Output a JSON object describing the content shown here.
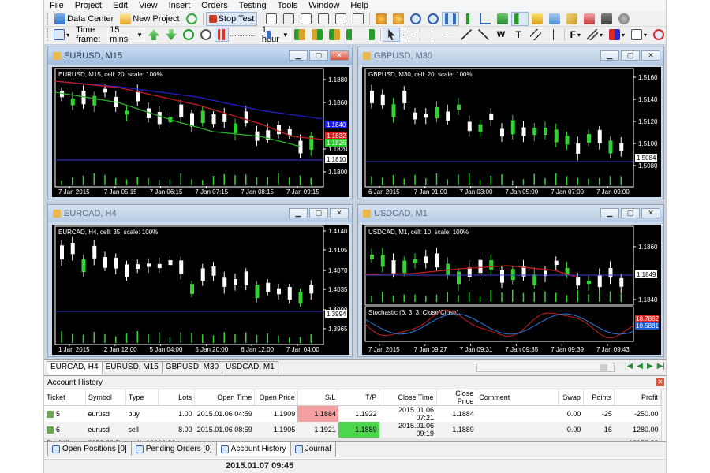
{
  "menu": [
    "File",
    "Project",
    "Edit",
    "View",
    "Insert",
    "Orders",
    "Testing",
    "Tools",
    "Window",
    "Help"
  ],
  "toolbar": {
    "data_center_label": "Data Center",
    "new_project_label": "New Project",
    "stop_test_label": "Stop Test",
    "timeframe_label": "Time frame:",
    "timeframe_value": "15 mins",
    "speed_value": "1 hour",
    "f_menu_label": "F"
  },
  "charts": [
    {
      "id": "eurusd",
      "window_title": "EURUSD, M15",
      "header": "EURUSD, M15, cell: 20, scale: 100%",
      "price_labels": [
        "1.1880",
        "1.1860",
        "1.1840",
        "1.1832",
        "1.1826",
        "1.1820",
        "1.1810",
        "1.1800"
      ],
      "time_labels": [
        "7 Jan 2015",
        "7 Jan 05:15",
        "7 Jan 06:15",
        "7 Jan 07:15",
        "7 Jan 08:15",
        "7 Jan 09:15"
      ],
      "badges": [
        {
          "value": "1.1840",
          "color": "#1a1aff",
          "text_color": "#ffffff"
        },
        {
          "value": "1.1832",
          "color": "#e02020",
          "text_color": "#ffffff"
        },
        {
          "value": "1.1826",
          "color": "#22cc22",
          "text_color": "#ffffff"
        },
        {
          "value": "1.1810",
          "color": "#ffffff",
          "text_color": "#000000"
        }
      ]
    },
    {
      "id": "gbpusd",
      "window_title": "GBPUSD, M30",
      "header": "GBPUSD, M30, cell: 20, scale: 100%",
      "price_labels": [
        "1.5160",
        "1.5140",
        "1.5120",
        "1.5100",
        "1.5084",
        "1.5080"
      ],
      "time_labels": [
        "6 Jan 2015",
        "7 Jan 01:00",
        "7 Jan 03:00",
        "7 Jan 05:00",
        "7 Jan 07:00",
        "7 Jan 09:00"
      ],
      "badges": [
        {
          "value": "1.5084",
          "color": "#ffffff",
          "text_color": "#000000"
        }
      ]
    },
    {
      "id": "eurcad",
      "window_title": "EURCAD, H4",
      "header": "EURCAD, H4, cell: 35, scale: 100%",
      "price_labels": [
        "1.4140",
        "1.4105",
        "1.4070",
        "1.4035",
        "1.4000",
        "1.3994",
        "1.3965"
      ],
      "time_labels": [
        "1 Jan 2015",
        "2 Jan 12:00",
        "5 Jan 04:00",
        "5 Jan 20:00",
        "6 Jan 12:00",
        "7 Jan 04:00"
      ],
      "badges": [
        {
          "value": "1.3994",
          "color": "#ffffff",
          "text_color": "#000000"
        }
      ]
    },
    {
      "id": "usdcad",
      "window_title": "USDCAD, M1",
      "header": "USDCAD, M1, cell: 10, scale: 100%",
      "price_labels": [
        "1.1860",
        "1.1849",
        "1.1840"
      ],
      "time_labels": [
        "7 Jan 2015",
        "7 Jan 09:27",
        "7 Jan 09:31",
        "7 Jan 09:35",
        "7 Jan 09:39",
        "7 Jan 09:43"
      ],
      "badges": [
        {
          "value": "1.1849",
          "color": "#ffffff",
          "text_color": "#000000"
        }
      ],
      "stochastic_header": "Stochastic (6, 3, 3, Close/Close)",
      "stochastic_badges": [
        {
          "value": "18.7882",
          "color": "#e02020",
          "text_color": "#ffffff"
        },
        {
          "value": "10.5881",
          "color": "#1a5ad6",
          "text_color": "#ffffff"
        }
      ]
    }
  ],
  "chart_tabs": [
    "EURCAD, H4",
    "EURUSD, M15",
    "GBPUSD, M30",
    "USDCAD, M1"
  ],
  "account_history": {
    "title": "Account History",
    "columns": [
      "Ticket",
      "Symbol",
      "Type",
      "Lots",
      "Open Time",
      "Open Price",
      "S/L",
      "T/P",
      "Close Time",
      "Close Price",
      "Comment",
      "Swap",
      "Points",
      "Profit"
    ],
    "rows": [
      [
        "5",
        "eurusd",
        "buy",
        "1.00",
        "2015.01.06 04:59",
        "1.1909",
        "1.1884",
        "1.1922",
        "2015.01.06 07:21",
        "1.1884",
        "",
        "0.00",
        "-25",
        "-250.00"
      ],
      [
        "6",
        "eurusd",
        "sell",
        "8.00",
        "2015.01.06 08:59",
        "1.1905",
        "1.1921",
        "1.1889",
        "2015.01.06 09:19",
        "1.1889",
        "",
        "0.00",
        "16",
        "1280.00"
      ]
    ],
    "summary_label": "Profit/Loss: 3153.30 Deposit: 10000.00",
    "summary_total": "13153.30"
  },
  "terminal_tabs": [
    "Open Positions [0]",
    "Pending Orders [0]",
    "Account History",
    "Journal"
  ],
  "status": {
    "time": "2015.01.07 09:45"
  },
  "colors": {
    "bull": "#ffffff",
    "bear": "#32d232",
    "grid_axis": "#ffffff",
    "ma_blue": "#2020c8",
    "ma_red": "#c81e1e",
    "ma_green": "#28b428",
    "sl_red": "#f4a0a0",
    "tp_green": "#4bd64b"
  },
  "icons": [
    "data-center-icon",
    "new-project-icon",
    "stop-icon",
    "zoom-in-icon",
    "zoom-out-icon",
    "crosshair-icon",
    "cursor-icon",
    "line-icon",
    "text-icon"
  ]
}
